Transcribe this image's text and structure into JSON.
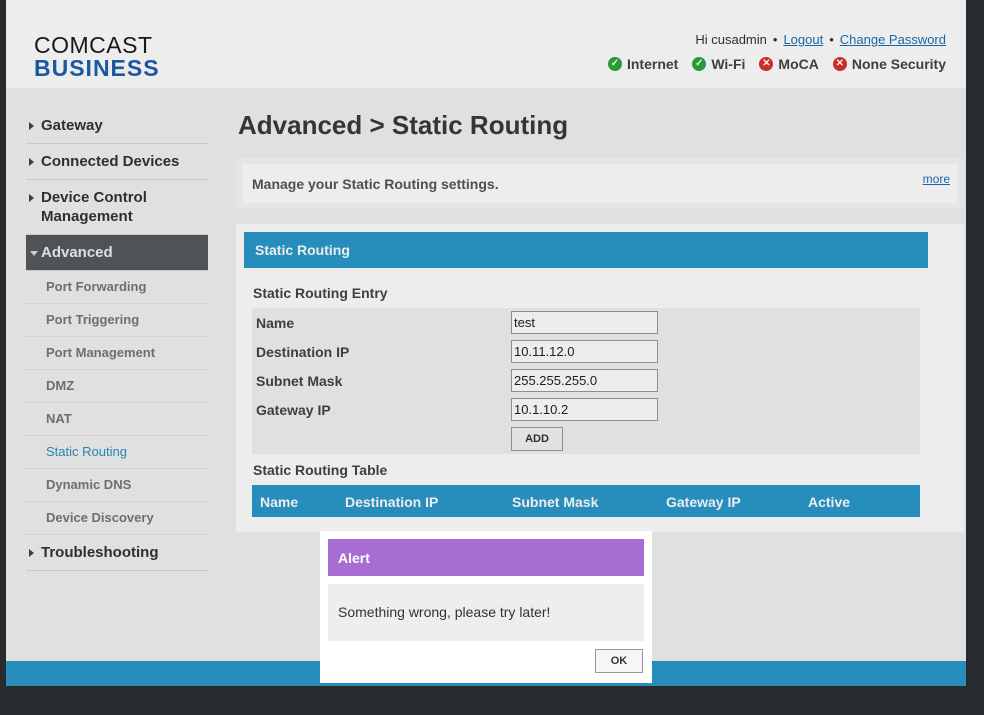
{
  "brand": {
    "line1": "COMCAST",
    "line2": "BUSINESS"
  },
  "user": {
    "greeting": "Hi cusadmin",
    "logout": "Logout",
    "change_password": "Change Password"
  },
  "status": [
    {
      "label": "Internet",
      "state": "ok",
      "icon": "check-icon"
    },
    {
      "label": "Wi-Fi",
      "state": "ok",
      "icon": "check-icon"
    },
    {
      "label": "MoCA",
      "state": "error",
      "icon": "x-icon"
    },
    {
      "label": "None Security",
      "state": "error",
      "icon": "x-icon"
    }
  ],
  "sidebar": {
    "gateway": "Gateway",
    "connected_devices": "Connected Devices",
    "device_control": "Device Control Management",
    "advanced": "Advanced",
    "sub": [
      "Port Forwarding",
      "Port Triggering",
      "Port Management",
      "DMZ",
      "NAT",
      "Static Routing",
      "Dynamic DNS",
      "Device Discovery"
    ],
    "troubleshooting": "Troubleshooting"
  },
  "main": {
    "title": "Advanced > Static Routing",
    "info": "Manage your Static Routing settings.",
    "more": "more",
    "module_title": "Static Routing",
    "entry_label": "Static Routing Entry",
    "form": {
      "name_label": "Name",
      "name_value": "test",
      "dest_label": "Destination IP",
      "dest_value": "10.11.12.0",
      "mask_label": "Subnet Mask",
      "mask_value": "255.255.255.0",
      "gw_label": "Gateway IP",
      "gw_value": "10.1.10.2",
      "add": "ADD"
    },
    "table_label": "Static Routing Table",
    "table_columns": [
      "Name",
      "Destination IP",
      "Subnet Mask",
      "Gateway IP",
      "Active"
    ]
  },
  "alert": {
    "title": "Alert",
    "message": "Something wrong, please try later!",
    "ok": "OK"
  },
  "colors": {
    "accent": "#2b98cc",
    "alert_header": "#a86dd3",
    "ok": "#2aa83a",
    "error": "#d9332a"
  }
}
